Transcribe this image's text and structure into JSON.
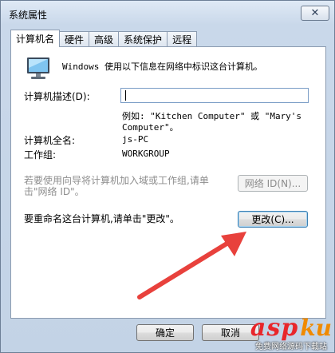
{
  "window": {
    "title": "系统属性",
    "close_glyph": "✕"
  },
  "tabs": [
    {
      "label": "计算机名",
      "active": true
    },
    {
      "label": "硬件",
      "active": false
    },
    {
      "label": "高级",
      "active": false
    },
    {
      "label": "系统保护",
      "active": false
    },
    {
      "label": "远程",
      "active": false
    }
  ],
  "panel": {
    "intro": "Windows 使用以下信息在网络中标识这台计算机。",
    "description_label": "计算机描述(D):",
    "description_value": "",
    "example_line1": "例如: \"Kitchen Computer\" 或 \"Mary's",
    "example_line2": "Computer\"。",
    "full_name_label": "计算机全名:",
    "full_name_value": "js-PC",
    "workgroup_label": "工作组:",
    "workgroup_value": "WORKGROUP",
    "network_hint_line1": "若要使用向导将计算机加入域或工作组,请单",
    "network_hint_line2": "击\"网络 ID\"。",
    "network_id_button": "网络 ID(N)...",
    "rename_hint": "要重命名这台计算机,请单击\"更改\"。",
    "change_button": "更改(C)..."
  },
  "footer": {
    "ok_button": "确定",
    "cancel_button": "取消"
  },
  "watermark": {
    "brand_left": "asp",
    "brand_right": "ku",
    "sub": "免费网络源码下载站"
  },
  "colors": {
    "arrow": "#e8413c",
    "watermark_red": "#e8262b",
    "watermark_orange": "#f08a00"
  },
  "icons": {
    "computer": "computer-monitor-icon",
    "close": "close-icon"
  }
}
